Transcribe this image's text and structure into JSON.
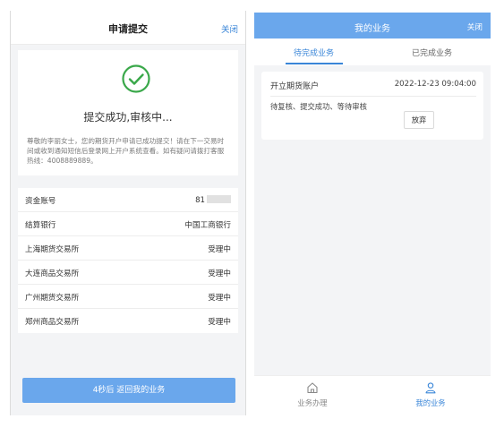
{
  "submit_page": {
    "title": "申请提交",
    "close_label": "关闭",
    "success_title": "提交成功,审核中...",
    "notice": "尊敬的李丽女士，您的期货开户申请已成功提交！请在下一交易时间或收到通知短信后登录网上开户系统查看。如有疑问请拨打客服热线：4008889889。",
    "info_rows": [
      {
        "label": "资金账号",
        "value": "81"
      },
      {
        "label": "结算银行",
        "value": "中国工商银行"
      },
      {
        "label": "上海期货交易所",
        "value": "受理中"
      },
      {
        "label": "大连商品交易所",
        "value": "受理中"
      },
      {
        "label": "广州期货交易所",
        "value": "受理中"
      },
      {
        "label": "郑州商品交易所",
        "value": "受理中"
      }
    ],
    "return_button": "4秒后 返回我的业务"
  },
  "business_page": {
    "title": "我的业务",
    "close_label": "关闭",
    "tabs": [
      {
        "label": "待完成业务",
        "active": true
      },
      {
        "label": "已完成业务",
        "active": false
      }
    ],
    "order": {
      "name": "开立期货账户",
      "time": "2022-12-23 09:04:00",
      "status": "待复核、提交成功、等待审核",
      "abandon_label": "放弃"
    },
    "nav": [
      {
        "label": "业务办理",
        "icon": "home-icon",
        "active": false
      },
      {
        "label": "我的业务",
        "icon": "user-icon",
        "active": true
      }
    ]
  },
  "colors": {
    "accent": "#3a86d8",
    "header_blue": "#6aa7ec",
    "success_green": "#3aa84a"
  }
}
